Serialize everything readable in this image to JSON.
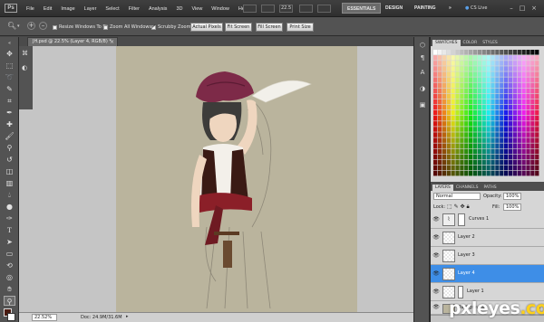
{
  "app": {
    "logo": "Ps"
  },
  "menubar": {
    "items": [
      "File",
      "Edit",
      "Image",
      "Layer",
      "Select",
      "Filter",
      "Analysis",
      "3D",
      "View",
      "Window",
      "Help"
    ],
    "zoom_value": "22.5",
    "workspaces": [
      "ESSENTIALS",
      "DESIGN",
      "PAINTING",
      "»"
    ],
    "cs_live": "CS Live"
  },
  "options_bar": {
    "resize_windows": "Resize Windows To Fit",
    "zoom_all_windows": "Zoom All Windows",
    "scrubby_zoom": "Scrubby Zoom",
    "buttons": [
      "Actual Pixels",
      "Fit Screen",
      "Fill Screen",
      "Print Size"
    ]
  },
  "document": {
    "tab_title": "JH.psd @ 22.5% (Layer 4, RGB/8) *",
    "zoom": "22.52%",
    "doc_size": "Doc: 24.9M/31.6M"
  },
  "swatches_panel": {
    "tabs": [
      "SWATCHES",
      "COLOR",
      "STYLES"
    ]
  },
  "layers_panel": {
    "tabs": [
      "LAYERS",
      "CHANNELS",
      "PATHS"
    ],
    "blend_mode": "Normal",
    "opacity_label": "Opacity:",
    "opacity_value": "100%",
    "lock_label": "Lock:",
    "fill_label": "Fill:",
    "fill_value": "100%",
    "layers": [
      {
        "name": "Curves 1",
        "selected": false
      },
      {
        "name": "Layer 2",
        "selected": false
      },
      {
        "name": "Layer 3",
        "selected": false
      },
      {
        "name": "Layer 4",
        "selected": true
      },
      {
        "name": "Layer 1",
        "selected": false
      },
      {
        "name": "Background",
        "selected": false
      }
    ]
  },
  "colors": {
    "foreground": "#4a1a10",
    "background": "#ffffff",
    "canvas_bg": "#bab49d",
    "selection": "#3e8ee7"
  },
  "watermark": {
    "text": "pxleyes",
    "tld": ".com"
  }
}
